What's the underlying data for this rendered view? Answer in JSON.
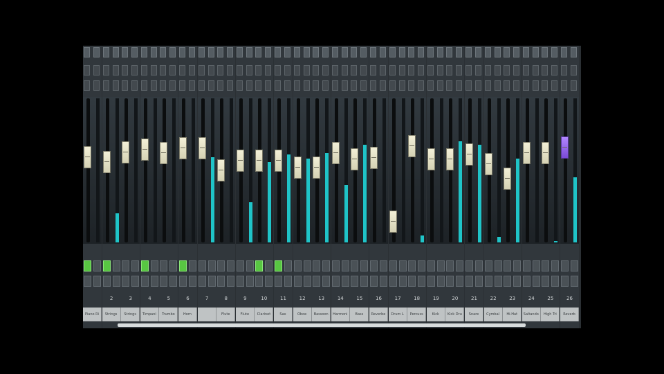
{
  "colors": {
    "meter": "#1fc4c8",
    "active_button": "#58c642",
    "selected_fader": "#8f5cf0"
  },
  "channels": [
    {
      "number": "",
      "name": "Piano Ri",
      "level": 0.61,
      "meter": 0.0,
      "db": "",
      "solo": true
    },
    {
      "number": "2",
      "name": "Strings",
      "level": 0.57,
      "meter": 0.2,
      "db": "",
      "solo": true
    },
    {
      "number": "3",
      "name": "Strings",
      "level": 0.65,
      "meter": 0.0,
      "db": "",
      "solo": false
    },
    {
      "number": "4",
      "name": "Timpani",
      "level": 0.67,
      "meter": 0.0,
      "db": "",
      "solo": true
    },
    {
      "number": "5",
      "name": "Trumbo",
      "level": 0.64,
      "meter": 0.0,
      "db": "",
      "solo": false
    },
    {
      "number": "6",
      "name": "Horn",
      "level": 0.68,
      "meter": 0.0,
      "db": "",
      "solo": true
    },
    {
      "number": "7",
      "name": "",
      "level": 0.68,
      "meter": 0.59,
      "db": "",
      "solo": false
    },
    {
      "number": "8",
      "name": "Flute",
      "level": 0.5,
      "meter": 0.0,
      "db": "",
      "solo": false
    },
    {
      "number": "9",
      "name": "Flute",
      "level": 0.58,
      "meter": 0.28,
      "db": "",
      "solo": false
    },
    {
      "number": "10",
      "name": "Clarinet",
      "level": 0.58,
      "meter": 0.56,
      "db": "",
      "solo": true
    },
    {
      "number": "11",
      "name": "Sax",
      "level": 0.58,
      "meter": 0.61,
      "db": "",
      "solo": true
    },
    {
      "number": "12",
      "name": "Oboe",
      "level": 0.52,
      "meter": 0.58,
      "db": "",
      "solo": false
    },
    {
      "number": "13",
      "name": "Bassoon",
      "level": 0.52,
      "meter": 0.62,
      "db": "",
      "solo": false
    },
    {
      "number": "14",
      "name": "Harmoni",
      "level": 0.64,
      "meter": 0.4,
      "db": "",
      "solo": false
    },
    {
      "number": "15",
      "name": "Bass",
      "level": 0.59,
      "meter": 0.68,
      "db": "",
      "solo": false
    },
    {
      "number": "16",
      "name": "Reverbe",
      "level": 0.6,
      "meter": 0.0,
      "db": "",
      "solo": false
    },
    {
      "number": "17",
      "name": "Drum L",
      "level": 0.08,
      "meter": 0.0,
      "db": "",
      "solo": false
    },
    {
      "number": "18",
      "name": "Percuss",
      "level": 0.7,
      "meter": 0.05,
      "db": "",
      "solo": false
    },
    {
      "number": "19",
      "name": "Kick",
      "level": 0.59,
      "meter": 0.0,
      "db": "",
      "solo": false
    },
    {
      "number": "20",
      "name": "Kick Dru",
      "level": 0.59,
      "meter": 0.7,
      "db": "",
      "solo": false
    },
    {
      "number": "21",
      "name": "Snare",
      "level": 0.63,
      "meter": 0.68,
      "db": "",
      "solo": false
    },
    {
      "number": "22",
      "name": "Cymbal",
      "level": 0.55,
      "meter": 0.04,
      "db": "",
      "solo": false
    },
    {
      "number": "23",
      "name": "Hi-Hat",
      "level": 0.43,
      "meter": 0.58,
      "db": "",
      "solo": false
    },
    {
      "number": "24",
      "name": "Saltando",
      "level": 0.64,
      "meter": 0.0,
      "db": "",
      "solo": false
    },
    {
      "number": "25",
      "name": "High Tri",
      "level": 0.64,
      "meter": 0.01,
      "db": "",
      "solo": false
    },
    {
      "number": "26",
      "name": "Reverb",
      "level": 0.69,
      "meter": 0.45,
      "db": "",
      "solo": false,
      "selected": true
    }
  ]
}
